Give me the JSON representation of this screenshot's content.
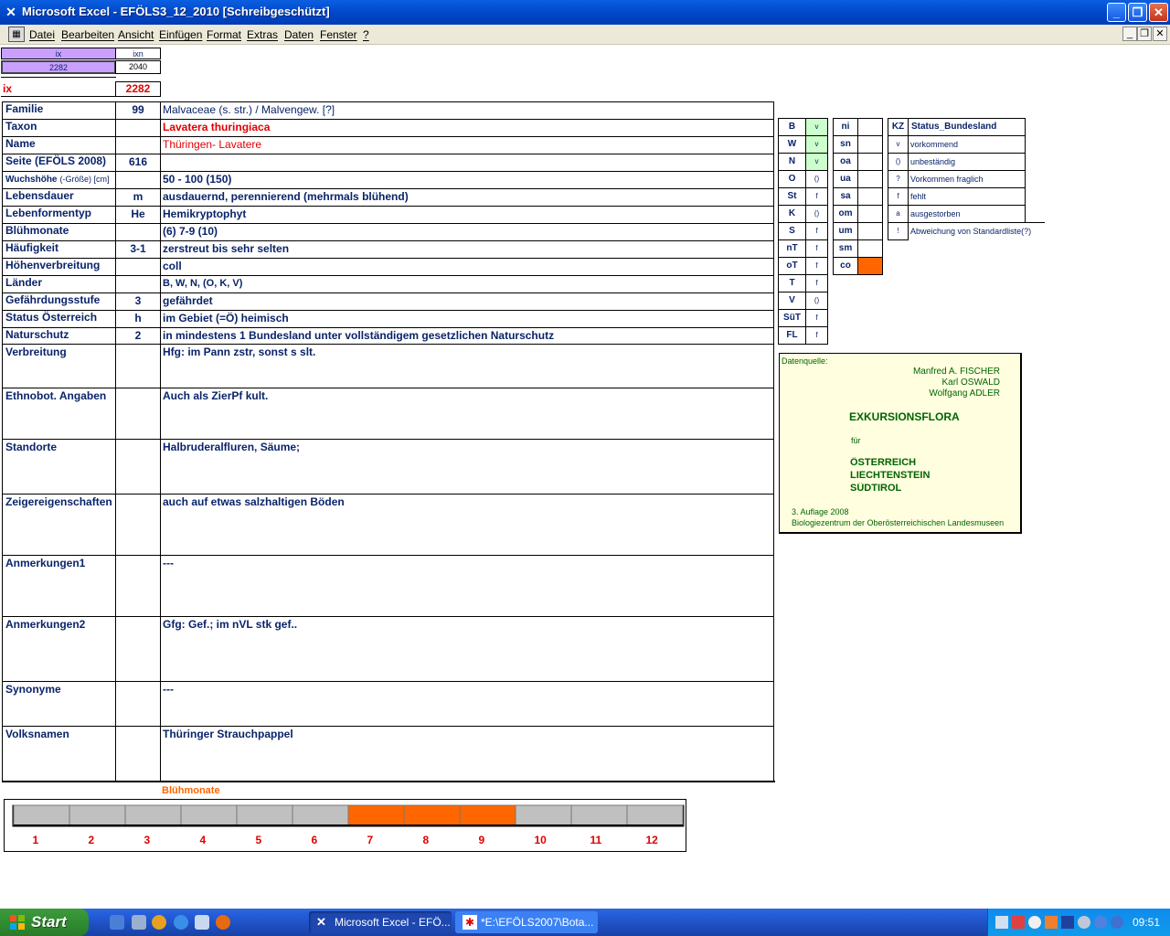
{
  "window": {
    "title": "Microsoft Excel - EFÖLS3_12_2010  [Schreibgeschützt]",
    "minimize": "_",
    "maximize": "❐",
    "close": "✕"
  },
  "menu": {
    "items": [
      "Datei",
      "Bearbeiten",
      "Ansicht",
      "Einfügen",
      "Format",
      "Extras",
      "Daten",
      "Fenster",
      "?"
    ],
    "doc_min": "_",
    "doc_restore": "❐",
    "doc_close": "✕"
  },
  "topcells": {
    "ix_header": "ix",
    "ixn_header": "ixn",
    "ix_small": "2282",
    "ixn_small": "2040",
    "ix_label": "ix",
    "ix_value": "2282"
  },
  "rows": [
    {
      "label": "Familie",
      "code": "99",
      "value": "Malvaceae (s. str.)  /  Malvengew. [?]"
    },
    {
      "label": "Taxon",
      "code": "",
      "value": "Lavatera thuringiaca"
    },
    {
      "label": "Name",
      "code": "",
      "value": "Thüringen- Lavatere"
    },
    {
      "label": "Seite (EFÖLS 2008)",
      "code": "616",
      "value": ""
    },
    {
      "label": "Wuchshöhe",
      "label_suffix": "(-Größe) [cm]",
      "code": "",
      "value": " 50 - 100 (150)"
    },
    {
      "label": "Lebensdauer",
      "code": "m",
      "value": "ausdauernd, perennierend (mehrmals blühend)"
    },
    {
      "label": "Lebenformentyp",
      "code": "He",
      "value": "Hemikryptophyt"
    },
    {
      "label": "Blühmonate",
      "code": "",
      "value": "(6) 7-9 (10)"
    },
    {
      "label": "Häufigkeit",
      "code": "3-1",
      "value": "zerstreut bis sehr selten"
    },
    {
      "label": "Höhenverbreitung",
      "code": "",
      "value": "coll"
    },
    {
      "label": "Länder",
      "code": "",
      "value": "B, W, N, (O, K, V)"
    },
    {
      "label": "Gefährdungsstufe",
      "code": "3",
      "value": "gefährdet"
    },
    {
      "label": "Status Österreich",
      "code": "h",
      "value": "im Gebiet (=Ö) heimisch"
    },
    {
      "label": "Naturschutz",
      "code": "2",
      "value": "in mindestens 1 Bundesland unter vollständigem gesetzlichen Naturschutz"
    },
    {
      "label": "Verbreitung",
      "code": "",
      "value": "Hfg:  im Pann zstr, sonst s slt."
    },
    {
      "label": "Ethnobot. Angaben",
      "code": "",
      "value": "Auch als ZierPf kult."
    },
    {
      "label": "Standorte",
      "code": "",
      "value": "Halbruderalfluren, Säume;"
    },
    {
      "label": "Zeigereigenschaften",
      "code": "",
      "value": "auch auf etwas salzhaltigen Böden"
    },
    {
      "label": "Anmerkungen1",
      "code": "",
      "value": "---"
    },
    {
      "label": "Anmerkungen2",
      "code": "",
      "value": "Gfg: Gef.; im nVL stk gef.."
    },
    {
      "label": "Synonyme",
      "code": "",
      "value": "---"
    },
    {
      "label": "Volksnamen",
      "code": "",
      "value": "Thüringer Strauchpappel"
    }
  ],
  "states": [
    {
      "k": "B",
      "v": "v"
    },
    {
      "k": "W",
      "v": "v"
    },
    {
      "k": "N",
      "v": "v"
    },
    {
      "k": "O",
      "v": "()"
    },
    {
      "k": "St",
      "v": "f"
    },
    {
      "k": "K",
      "v": "()"
    },
    {
      "k": "S",
      "v": "f"
    },
    {
      "k": "nT",
      "v": "f"
    },
    {
      "k": "oT",
      "v": "f"
    },
    {
      "k": "T",
      "v": "f"
    },
    {
      "k": "V",
      "v": "()"
    },
    {
      "k": "SüT",
      "v": "f"
    },
    {
      "k": "FL",
      "v": "f"
    }
  ],
  "regions": [
    "ni",
    "sn",
    "oa",
    "ua",
    "sa",
    "om",
    "um",
    "sm",
    "co"
  ],
  "legend": {
    "header_kz": "KZ",
    "header_status": "Status_Bundesland",
    "items": [
      {
        "kz": "v",
        "text": "vorkommend"
      },
      {
        "kz": "()",
        "text": "unbeständig"
      },
      {
        "kz": "?",
        "text": "Vorkommen fraglich"
      },
      {
        "kz": "f",
        "text": "fehlt"
      },
      {
        "kz": "a",
        "text": "ausgestorben"
      },
      {
        "kz": "!",
        "text": "Abweichung von Standardliste(?)"
      }
    ]
  },
  "source": {
    "label": "Datenquelle:",
    "authors": [
      "Manfred A. FISCHER",
      "Karl OSWALD",
      "Wolfgang ADLER"
    ],
    "title": "EXKURSIONSFLORA",
    "fuer": "für",
    "countries": [
      "ÖSTERREICH",
      "LIECHTENSTEIN",
      "SÜDTIROL"
    ],
    "edition": "3. Auflage 2008",
    "publisher": "Biologiezentrum der Oberösterreichischen Landesmuseen"
  },
  "bloom": {
    "title": "Blühmonate",
    "months": [
      "1",
      "2",
      "3",
      "4",
      "5",
      "6",
      "7",
      "8",
      "9",
      "10",
      "11",
      "12"
    ],
    "active": [
      false,
      false,
      false,
      false,
      false,
      false,
      true,
      true,
      true,
      false,
      false,
      false
    ]
  },
  "colors": {
    "accent_orange": "#ff6600",
    "header_purple": "#c9a0ff",
    "light_green": "#ccffcc",
    "source_bg": "#ffffe0",
    "bar_grey": "#c0c0c0"
  },
  "taskbar": {
    "start": "Start",
    "tasks": [
      "Microsoft Excel - EFÖ...",
      "*E:\\EFÖLS2007\\Bota..."
    ],
    "clock": "09:51"
  }
}
